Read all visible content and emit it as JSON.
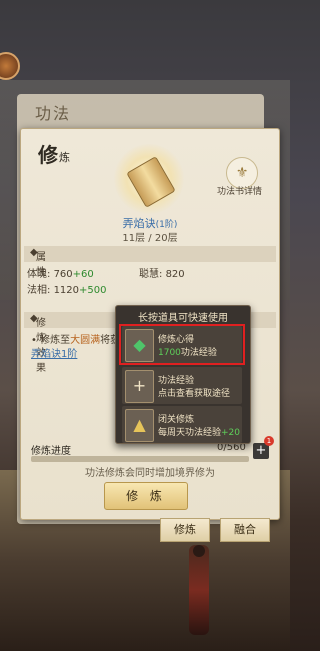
{
  "background": {
    "title": "功法"
  },
  "panel": {
    "title_big": "修",
    "title_small": "炼",
    "detail_label": "功法书详情",
    "gongfa_name": "弄焰诀",
    "gongfa_level": "(1阶)",
    "layer": "11层 / 20层"
  },
  "attributes": {
    "header": "属性",
    "stats": [
      {
        "label": "体魄: ",
        "value": "760",
        "plus": "+60"
      },
      {
        "label": "聪慧: ",
        "value": "820",
        "plus": ""
      },
      {
        "label": "法相: ",
        "value": "1120",
        "plus": "+500"
      }
    ]
  },
  "effect": {
    "header": "修炼效果",
    "line1_prefix": "• 修炼至",
    "line1_hl": "大圆满",
    "line1_suffix": "将获",
    "line2": "弄焰诀1阶"
  },
  "progress": {
    "label": "修炼进度",
    "value": "0/560",
    "fraction": 0,
    "badge": "1",
    "hint": "功法修炼会同时增加境界修为",
    "button": "修 炼"
  },
  "popup": {
    "title": "长按道具可快速使用",
    "items": [
      {
        "icon": "green-gem-icon",
        "name": "修炼心得",
        "line2_green": "1700",
        "line2": "功法经验"
      },
      {
        "icon": "plus-icon",
        "name": "功法经验",
        "line2_green": "",
        "line2": "点击查看获取途径"
      },
      {
        "icon": "closed-practice-icon",
        "name": "闭关修炼",
        "line2_green": "+20",
        "line2": "每周天功法经验"
      }
    ]
  },
  "bottom": {
    "practice": "修炼",
    "fusion": "融合"
  }
}
